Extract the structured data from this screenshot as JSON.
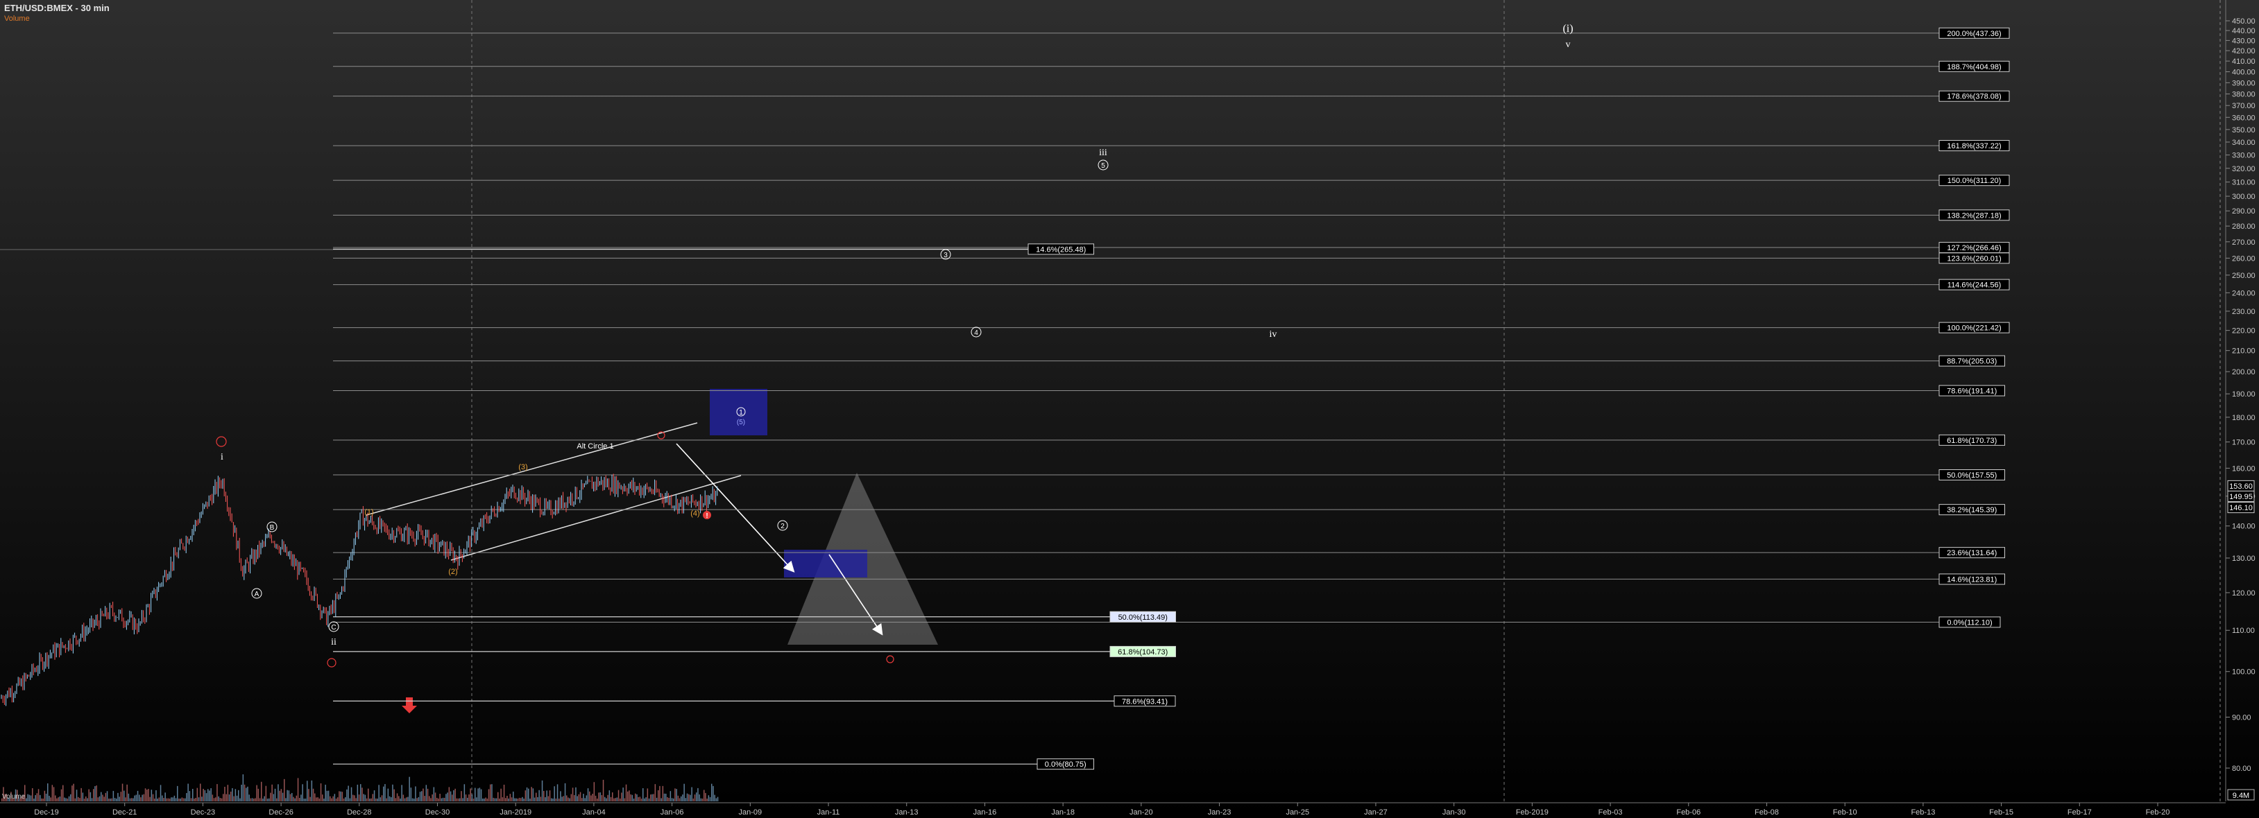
{
  "header": {
    "title": "ETH/USD:BMEX - 30 min",
    "subtitle": "Volume"
  },
  "chart_data": {
    "type": "candlestick",
    "y_axis_ticks": [
      80,
      90,
      100,
      110,
      120,
      130,
      140,
      150,
      160,
      170,
      180,
      190,
      200,
      210,
      220,
      230,
      240,
      250,
      260,
      270,
      280,
      290,
      300,
      310,
      320,
      330,
      340,
      350,
      360,
      370,
      380,
      390,
      400,
      410,
      420,
      430,
      440,
      450
    ],
    "y_axis_tick_labels": [
      "80.00",
      "90.00",
      "100.00",
      "110.00",
      "120.00",
      "130.00",
      "140.00",
      "150.00",
      "160.00",
      "170.00",
      "180.00",
      "190.00",
      "200.00",
      "210.00",
      "220.00",
      "230.00",
      "240.00",
      "250.00",
      "260.00",
      "270.00",
      "280.00",
      "290.00",
      "300.00",
      "310.00",
      "320.00",
      "330.00",
      "340.00",
      "350.00",
      "360.00",
      "370.00",
      "380.00",
      "390.00",
      "400.00",
      "410.00",
      "420.00",
      "430.00",
      "440.00",
      "450.00"
    ],
    "x_axis_labels": [
      "Dec-19",
      "Dec-21",
      "Dec-23",
      "Dec-26",
      "Dec-28",
      "Dec-30",
      "Jan-2019",
      "Jan-04",
      "Jan-06",
      "Jan-09",
      "Jan-11",
      "Jan-13",
      "Jan-16",
      "Jan-18",
      "Jan-20",
      "Jan-23",
      "Jan-25",
      "Jan-27",
      "Jan-30",
      "Feb-2019",
      "Feb-03",
      "Feb-06",
      "Feb-08",
      "Feb-10",
      "Feb-13",
      "Feb-15",
      "Feb-17",
      "Feb-20"
    ],
    "price_tags": [
      {
        "value": 153.6,
        "label": "153.60"
      },
      {
        "value": 149.95,
        "label": "149.95"
      },
      {
        "value": 146.1,
        "label": "146.10"
      }
    ],
    "volume_tag": "9.4M",
    "volume_label": "Volume",
    "fib_right": [
      {
        "value": 437.36,
        "label": "200.0%(437.36)"
      },
      {
        "value": 404.98,
        "label": "188.7%(404.98)"
      },
      {
        "value": 378.08,
        "label": "178.6%(378.08)"
      },
      {
        "value": 337.22,
        "label": "161.8%(337.22)"
      },
      {
        "value": 311.2,
        "label": "150.0%(311.20)"
      },
      {
        "value": 287.18,
        "label": "138.2%(287.18)"
      },
      {
        "value": 266.46,
        "label": "127.2%(266.46)"
      },
      {
        "value": 260.01,
        "label": "123.6%(260.01)"
      },
      {
        "value": 244.56,
        "label": "114.6%(244.56)"
      },
      {
        "value": 221.42,
        "label": "100.0%(221.42)"
      },
      {
        "value": 205.03,
        "label": "88.7%(205.03)"
      },
      {
        "value": 191.41,
        "label": "78.6%(191.41)"
      },
      {
        "value": 170.73,
        "label": "61.8%(170.73)"
      },
      {
        "value": 157.55,
        "label": "50.0%(157.55)"
      },
      {
        "value": 145.39,
        "label": "38.2%(145.39)"
      },
      {
        "value": 131.64,
        "label": "23.6%(131.64)"
      },
      {
        "value": 123.81,
        "label": "14.6%(123.81)"
      },
      {
        "value": 112.1,
        "label": "0.0%(112.10)"
      }
    ],
    "fib_mid": [
      {
        "value": 265.48,
        "label": "14.6%(265.48)"
      },
      {
        "value": 113.49,
        "label": "50.0%(113.49)",
        "bg": "#dfe6ff"
      },
      {
        "value": 104.73,
        "label": "61.8%(104.73)",
        "bg": "#d6ffd6"
      },
      {
        "value": 93.41,
        "label": "78.6%(93.41)"
      },
      {
        "value": 80.75,
        "label": "0.0%(80.75)"
      }
    ],
    "annotations": {
      "alt_label": "Alt Circle 1",
      "wave_i_top": "i",
      "wave_ii": "ii",
      "wave_iii": "iii",
      "wave_iv": "iv",
      "wave_v": "v",
      "wave_i_paren": "(i)",
      "circle_c": "C",
      "circle_a": "A",
      "circle_b": "B",
      "circle_1": "1",
      "circle_2": "2",
      "circle_3": "3",
      "circle_4": "4",
      "circle_5": "5",
      "paren_1": "(1)",
      "paren_2": "(2)",
      "paren_3": "(3)",
      "paren_4": "(4)",
      "paren_5": "(5)",
      "red_mark": "!"
    },
    "colors": {
      "background": "#000000",
      "up_candle": "#9ad7ff",
      "down_candle": "#ff5a5a",
      "fib_line": "#8c8c8c",
      "blue_box": "#22229a",
      "triangle": "#bfbfbf",
      "orange_label": "#e8a33a",
      "red_label": "#e83a3a"
    }
  }
}
